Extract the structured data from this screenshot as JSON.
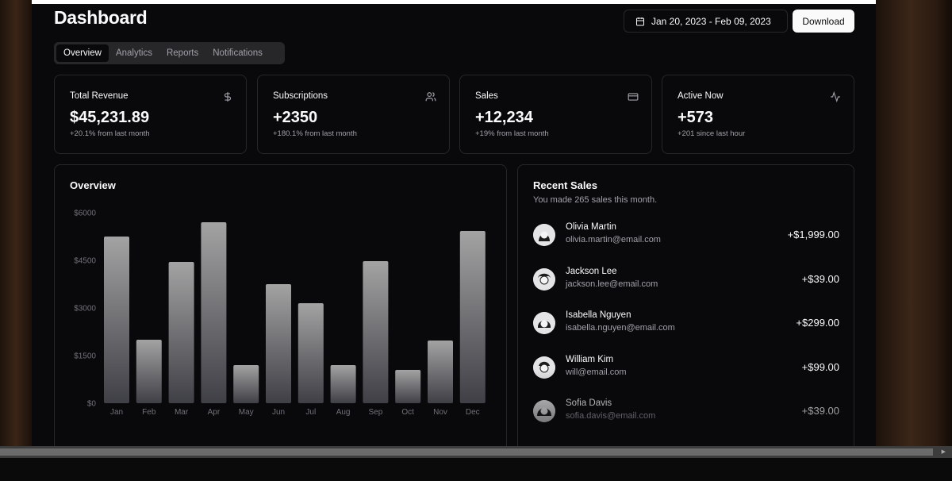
{
  "header": {
    "title": "Dashboard",
    "date_range": "Jan 20, 2023 - Feb 09, 2023",
    "download_label": "Download"
  },
  "tabs": [
    {
      "label": "Overview",
      "active": true
    },
    {
      "label": "Analytics",
      "active": false
    },
    {
      "label": "Reports",
      "active": false
    },
    {
      "label": "Notifications",
      "active": false
    }
  ],
  "stats": [
    {
      "label": "Total Revenue",
      "value": "$45,231.89",
      "sub": "+20.1% from last month",
      "icon": "dollar-icon"
    },
    {
      "label": "Subscriptions",
      "value": "+2350",
      "sub": "+180.1% from last month",
      "icon": "users-icon"
    },
    {
      "label": "Sales",
      "value": "+12,234",
      "sub": "+19% from last month",
      "icon": "credit-card-icon"
    },
    {
      "label": "Active Now",
      "value": "+573",
      "sub": "+201 since last hour",
      "icon": "activity-icon"
    }
  ],
  "overview": {
    "title": "Overview"
  },
  "chart_data": {
    "type": "bar",
    "title": "Overview",
    "categories": [
      "Jan",
      "Feb",
      "Mar",
      "Apr",
      "May",
      "Jun",
      "Jul",
      "Aug",
      "Sep",
      "Oct",
      "Nov",
      "Dec"
    ],
    "values": [
      5250,
      2000,
      4450,
      5700,
      1200,
      3750,
      3150,
      1200,
      4475,
      1050,
      1975,
      5425
    ],
    "yticks": [
      "$0",
      "$1500",
      "$3000",
      "$4500",
      "$6000"
    ],
    "ylim": [
      0,
      6000
    ],
    "grid": false,
    "bar_color_top": "#a3a3a3",
    "bar_color_bottom": "#3f3f46"
  },
  "recent_sales": {
    "title": "Recent Sales",
    "description": "You made 265 sales this month.",
    "items": [
      {
        "name": "Olivia Martin",
        "email": "olivia.martin@email.com",
        "amount": "+$1,999.00"
      },
      {
        "name": "Jackson Lee",
        "email": "jackson.lee@email.com",
        "amount": "+$39.00"
      },
      {
        "name": "Isabella Nguyen",
        "email": "isabella.nguyen@email.com",
        "amount": "+$299.00"
      },
      {
        "name": "William Kim",
        "email": "will@email.com",
        "amount": "+$99.00"
      },
      {
        "name": "Sofia Davis",
        "email": "sofia.davis@email.com",
        "amount": "+$39.00"
      }
    ]
  },
  "colors": {
    "background": "#09090b",
    "border": "#27272a",
    "muted_text": "#a1a1aa",
    "foreground": "#fafafa"
  }
}
